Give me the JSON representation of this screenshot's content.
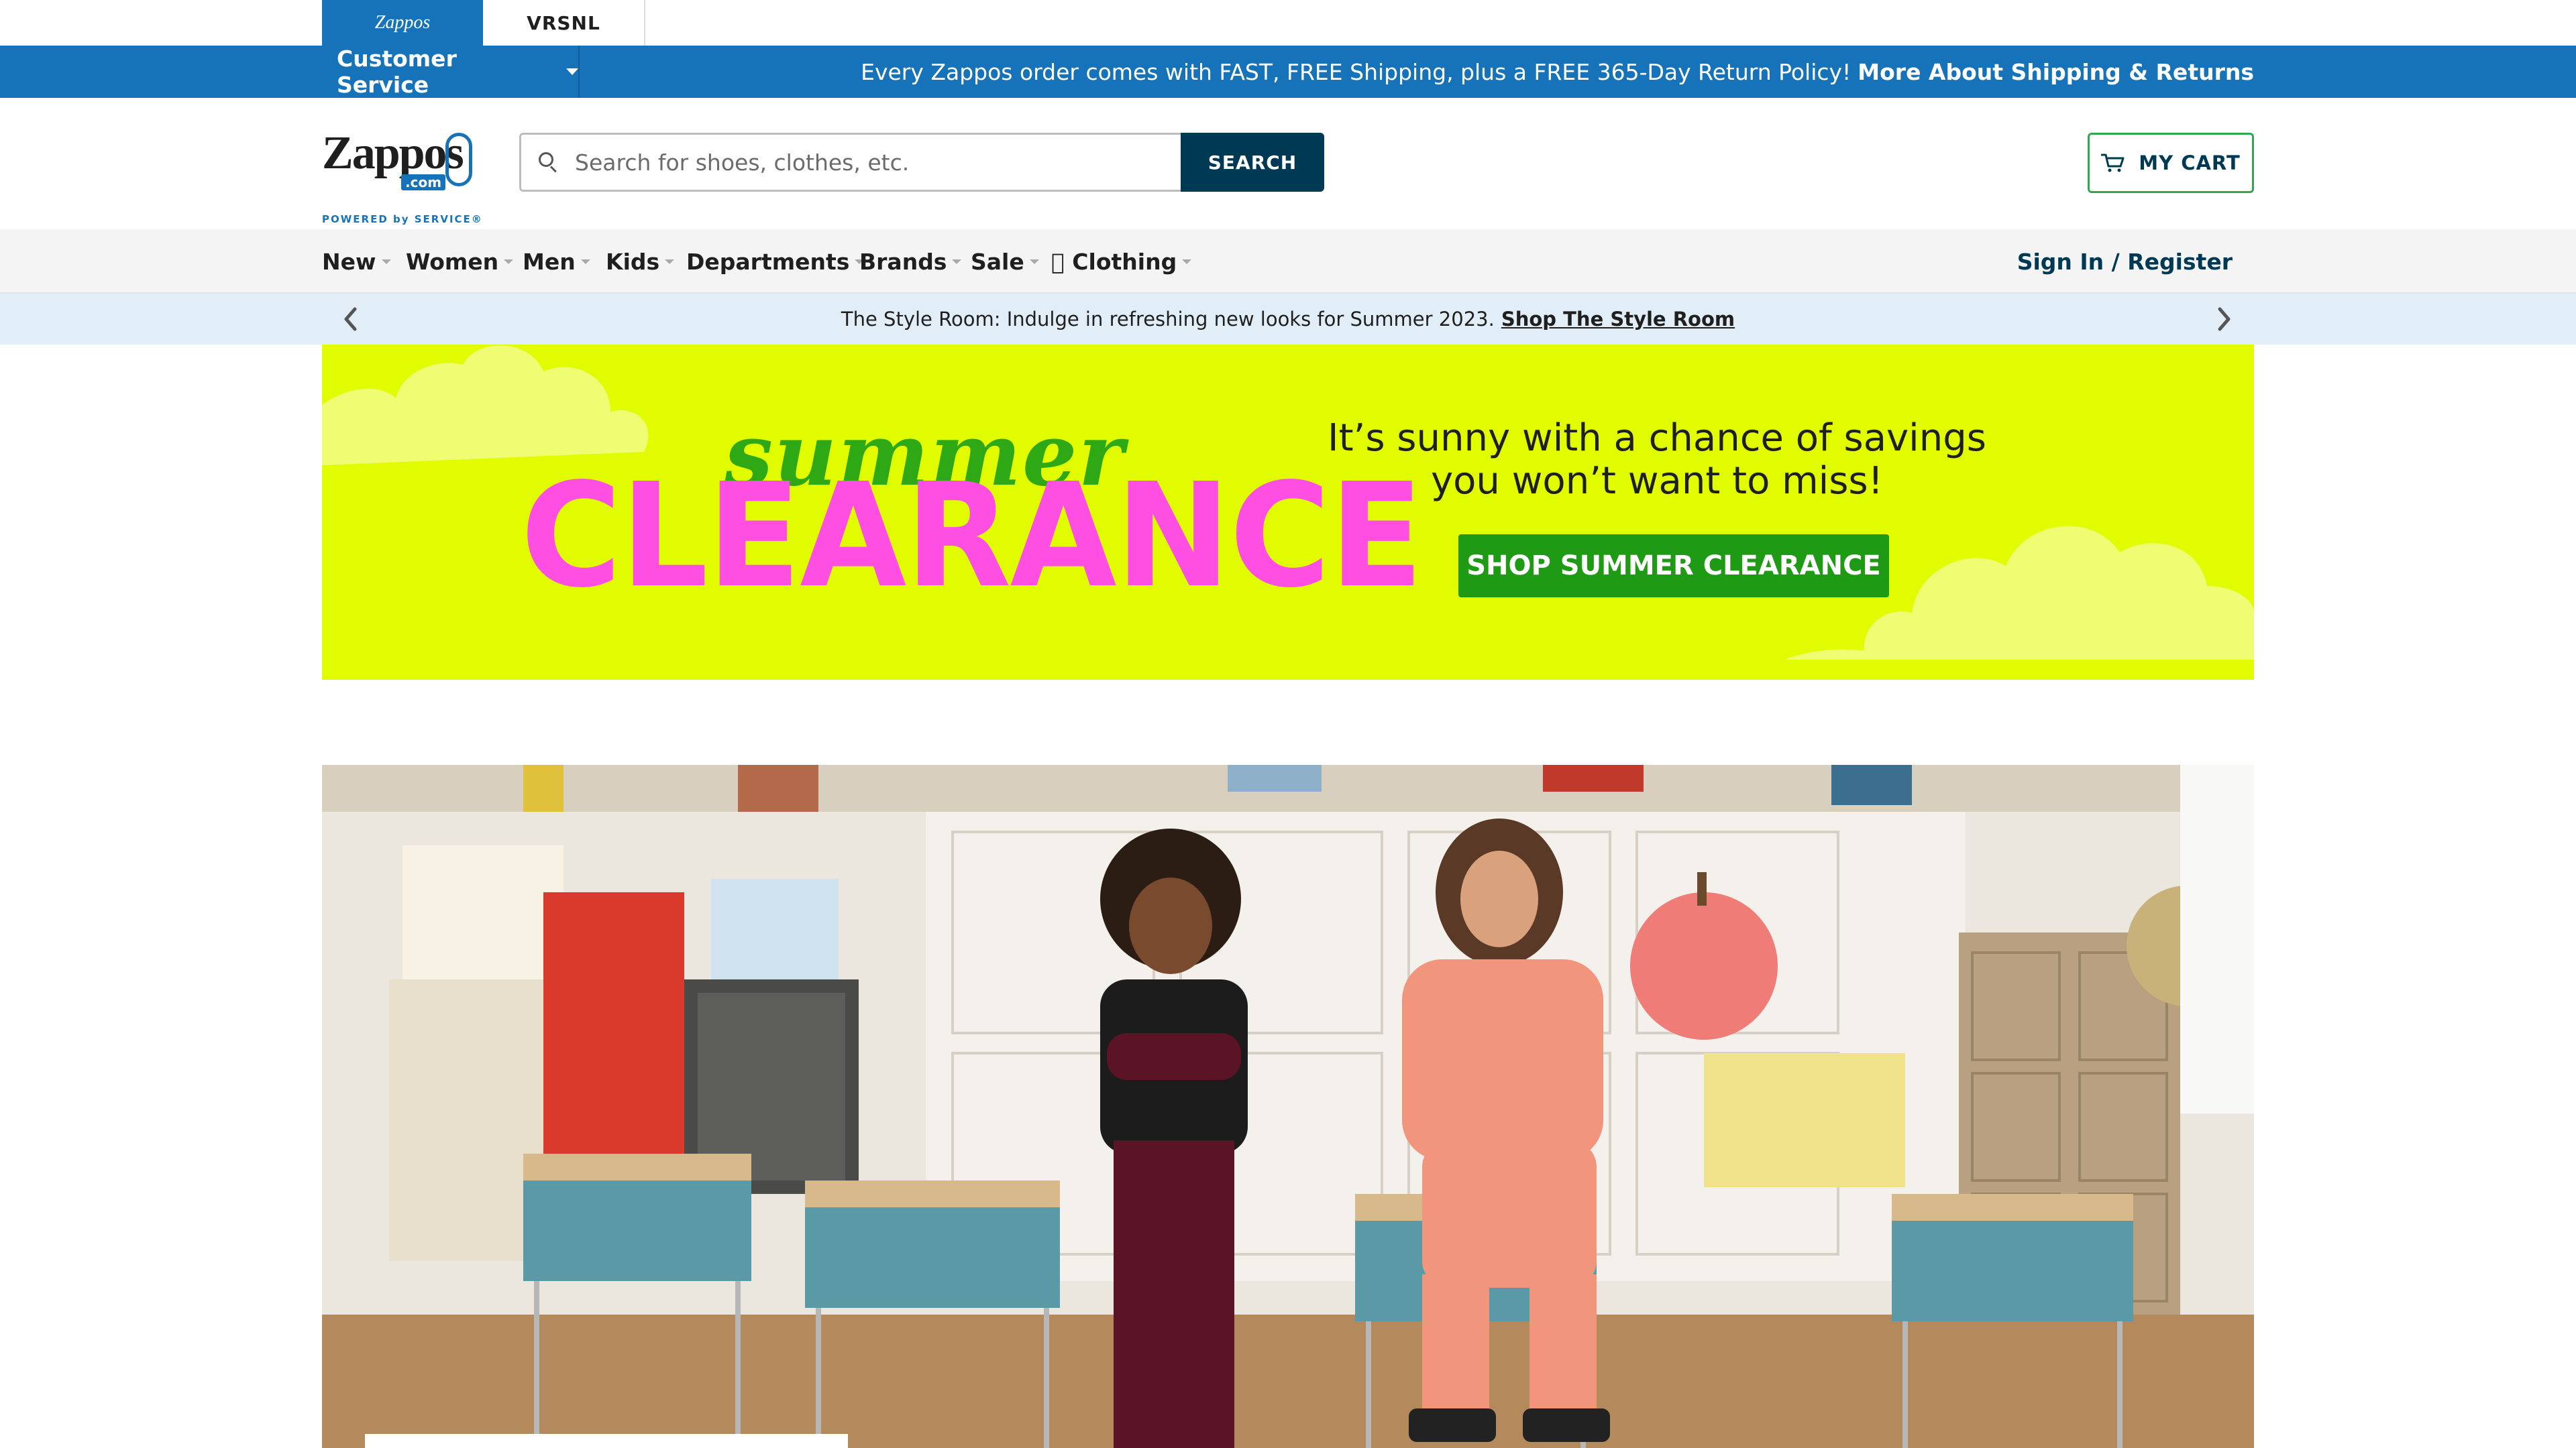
{
  "brand_tabs": [
    {
      "label": "Zappos"
    },
    {
      "label": "VRSNL"
    }
  ],
  "service_bar": {
    "customer_service_label": "Customer Service",
    "shipping_message": "Every Zappos order comes with FAST, FREE Shipping, plus a FREE 365-Day Return Policy!",
    "shipping_link": "More About Shipping & Returns"
  },
  "header": {
    "logo_word": "Zappos",
    "logo_com": ".com",
    "logo_tagline": "POWERED by SERVICE®",
    "search_placeholder": "Search for shoes, clothes, etc.",
    "search_button": "SEARCH",
    "cart_label": "MY CART"
  },
  "nav": {
    "items": [
      {
        "label": "New"
      },
      {
        "label": "Women"
      },
      {
        "label": "Men"
      },
      {
        "label": "Kids"
      },
      {
        "label": "Departments"
      },
      {
        "label": "Brands"
      },
      {
        "label": "Sale"
      },
      {
        "label": "\u0000 Clothing"
      }
    ],
    "signin_label": "Sign In / Register"
  },
  "promo": {
    "text": "The Style Room: Indulge in refreshing new looks for Summer 2023.",
    "link": "Shop The Style Room"
  },
  "banner": {
    "word_top": "summer",
    "word_main": "CLEARANCE",
    "headline_line1": "It’s sunny with a chance of savings",
    "headline_line2": "you won’t want to miss!",
    "cta": "SHOP SUMMER CLEARANCE"
  },
  "colors": {
    "brand_blue": "#1673b9",
    "dark_navy": "#003953",
    "cart_green": "#2fa84f",
    "banner_bg": "#e2fc00",
    "clearance_pink": "#ff4fe3",
    "cta_green": "#1f9a14",
    "promo_bg": "#e1eef8"
  },
  "icons": {
    "search": "search-icon",
    "cart": "cart-icon",
    "prev": "chevron-left-icon",
    "next": "chevron-right-icon"
  }
}
